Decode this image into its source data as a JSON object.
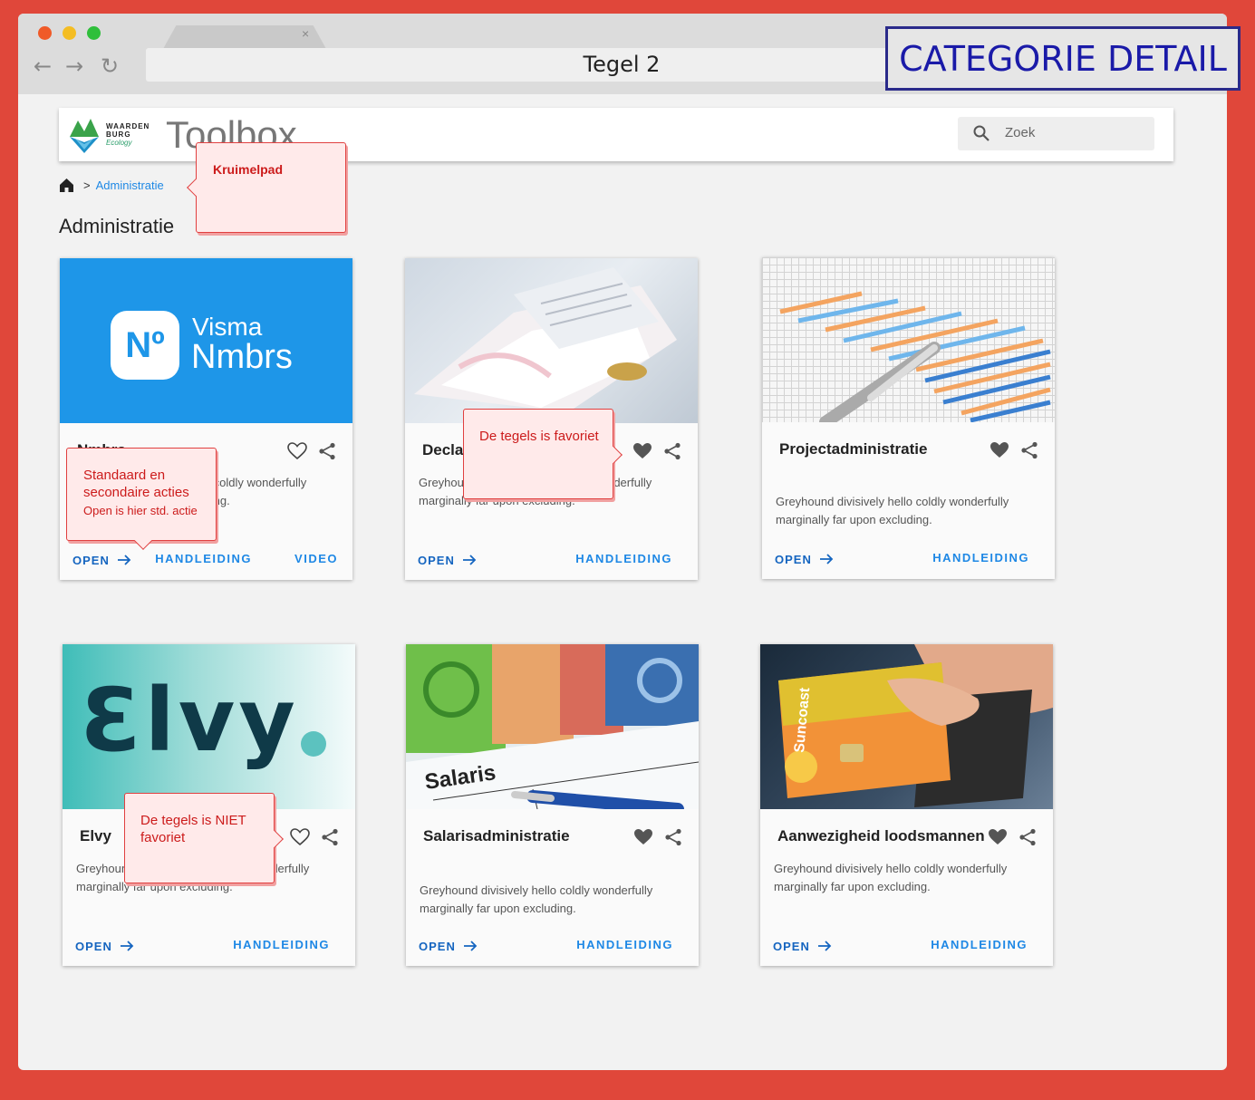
{
  "browser": {
    "url_title": "Tegel 2",
    "tab_close": "×",
    "back": "←",
    "forward": "→",
    "reload": "↻"
  },
  "stamp": "CATEGORIE DETAIL",
  "header": {
    "logo_line1": "WAARDEN",
    "logo_line2": "BURG",
    "logo_line3": "Ecology",
    "app_name": "Toolbox",
    "search_placeholder": "Zoek"
  },
  "breadcrumb": {
    "separator": ">",
    "current": "Administratie"
  },
  "page_title": "Administratie",
  "notes": {
    "kruimelpad": "Kruimelpad",
    "acties_title": "Standaard en secondaire acties",
    "acties_sub": "Open is hier std. actie",
    "favoriet": "De tegels is favoriet",
    "niet_favoriet": "De tegels is NIET favoriet"
  },
  "cards": [
    {
      "title": "Nmbrs",
      "desc": "Greyhound divisively hello coldly wonderfully marginally far upon excluding.",
      "open": "OPEN",
      "manual": "HANDLEIDING",
      "video": "VIDEO",
      "favorite": false,
      "logo_top": "Visma",
      "logo_bottom": "Nmbrs",
      "logo_mark": "Nº"
    },
    {
      "title": "Declaraties",
      "desc": "Greyhound divisively hello coldly wonderfully marginally far upon excluding.",
      "open": "OPEN",
      "manual": "HANDLEIDING",
      "favorite": true
    },
    {
      "title": "Projectadministratie",
      "desc": "Greyhound divisively hello coldly wonderfully marginally far upon excluding.",
      "open": "OPEN",
      "manual": "HANDLEIDING",
      "favorite": true
    },
    {
      "title": "Elvy",
      "desc": "Greyhound divisively hello coldly wonderfully marginally far upon excluding.",
      "open": "OPEN",
      "manual": "HANDLEIDING",
      "favorite": false,
      "logo_text": "Ɛlvy"
    },
    {
      "title": "Salarisadministratie",
      "desc": "Greyhound divisively hello coldly wonderfully marginally far upon excluding.",
      "open": "OPEN",
      "manual": "HANDLEIDING",
      "favorite": true,
      "image_label": "Salaris"
    },
    {
      "title": "Aanwezigheid loodsmannen",
      "desc": "Greyhound divisively hello coldly wonderfully marginally far upon excluding.",
      "open": "OPEN",
      "manual": "HANDLEIDING",
      "favorite": true,
      "image_label": "Suncoast"
    }
  ],
  "colors": {
    "accent": "#1e88e5",
    "open": "#1565c0",
    "note": "#cc1b1b",
    "frame": "#e0473a"
  }
}
